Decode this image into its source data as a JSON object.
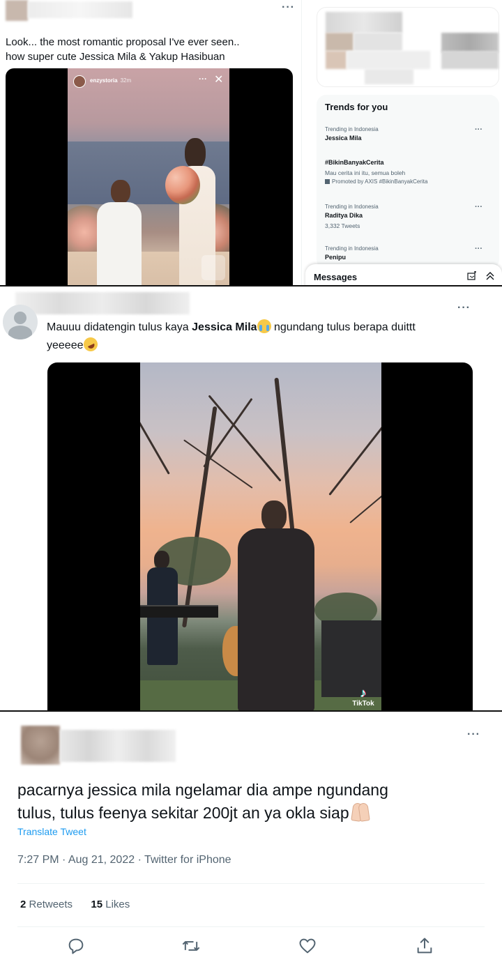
{
  "panel1": {
    "tweet_text_line1": "Look... the most romantic proposal I've ever seen..",
    "tweet_text_line2": "how super cute Jessica Mila & Yakup Hasibuan",
    "story": {
      "handle": "enzystoria",
      "age": "32m"
    },
    "trends": {
      "title": "Trends for you",
      "items": [
        {
          "context": "Trending in Indonesia",
          "name": "Jessica Mila"
        },
        {
          "name": "#BikinBanyakCerita",
          "description": "Mau cerita ini itu, semua boleh",
          "promoted": "Promoted by AXIS #BikinBanyakCerita"
        },
        {
          "context": "Trending in Indonesia",
          "name": "Raditya Dika",
          "count": "3,332 Tweets"
        },
        {
          "context": "Trending in Indonesia",
          "name": "Penipu"
        }
      ]
    },
    "messages_label": "Messages"
  },
  "panel2": {
    "text_before": "Mauuu didatengin tulus kaya ",
    "text_bold": "Jessica Mila",
    "text_after": " ngundang tulus berapa duittt",
    "text_line2": "yeeeee",
    "watermark": "TikTok"
  },
  "panel3": {
    "tweet_text_line1": "pacarnya jessica mila ngelamar dia ampe ngundang",
    "tweet_text_line2": "tulus, tulus feenya sekitar 200jt an ya okla siap",
    "translate_label": "Translate Tweet",
    "timestamp": "7:27 PM · Aug 21, 2022 · Twitter for iPhone",
    "retweets_count": "2",
    "retweets_label": "Retweets",
    "likes_count": "15",
    "likes_label": "Likes"
  },
  "icons": [
    "more-icon",
    "compose-message-icon",
    "collapse-icon",
    "reply-icon",
    "retweet-icon",
    "like-icon",
    "share-icon",
    "tiktok-logo-icon"
  ],
  "colors": {
    "link": "#1d9bf0",
    "secondary_text": "#536471",
    "primary_text": "#0f1419"
  }
}
